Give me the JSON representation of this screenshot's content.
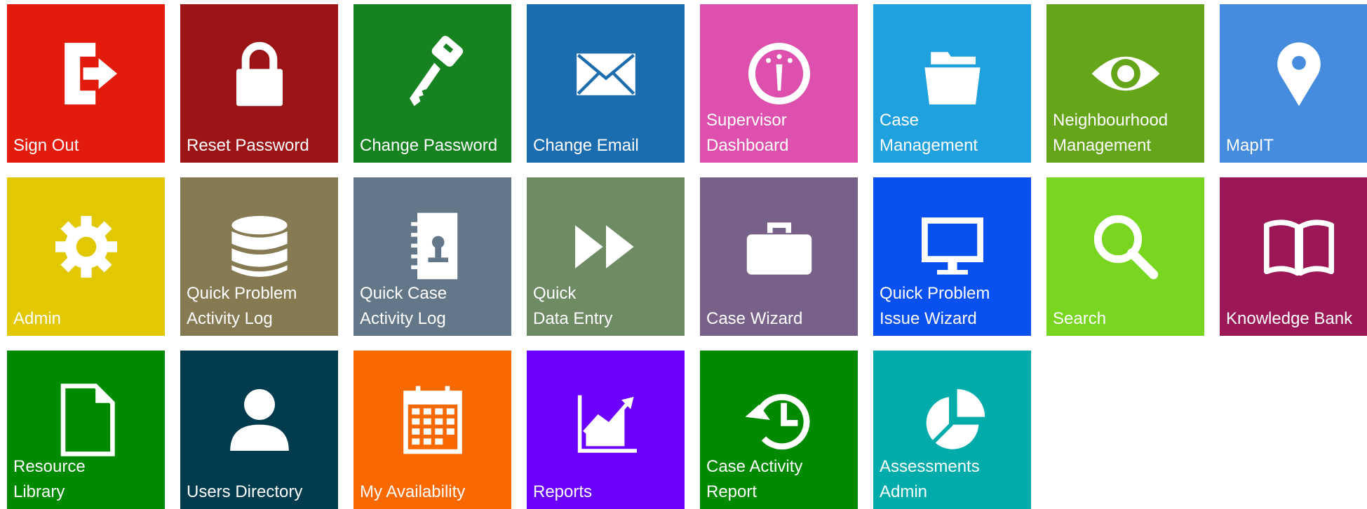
{
  "tiles": [
    {
      "id": "sign-out",
      "lines": [
        "Sign Out"
      ],
      "color": "#e31b0d",
      "icon": "sign-out-icon"
    },
    {
      "id": "reset-password",
      "lines": [
        "Reset Password"
      ],
      "color": "#9b1517",
      "icon": "lock-icon"
    },
    {
      "id": "change-password",
      "lines": [
        "Change Password"
      ],
      "color": "#168220",
      "icon": "key-icon"
    },
    {
      "id": "change-email",
      "lines": [
        "Change Email"
      ],
      "color": "#1c6daf",
      "icon": "envelope-icon"
    },
    {
      "id": "supervisor-dashboard",
      "lines": [
        "Supervisor",
        "Dashboard"
      ],
      "color": "#dd50ad",
      "icon": "gauge-icon"
    },
    {
      "id": "case-management",
      "lines": [
        "Case",
        "Management"
      ],
      "color": "#1fa1e0",
      "icon": "folder-icon"
    },
    {
      "id": "neighbourhood-management",
      "lines": [
        "Neighbourhood",
        "Management"
      ],
      "color": "#64a51a",
      "icon": "eye-icon"
    },
    {
      "id": "mapit",
      "lines": [
        "MapIT"
      ],
      "color": "#458cdf",
      "icon": "map-pin-icon"
    },
    {
      "id": "admin",
      "lines": [
        "Admin"
      ],
      "color": "#e2c800",
      "icon": "gear-icon"
    },
    {
      "id": "quick-problem-activity-log",
      "lines": [
        "Quick Problem",
        "Activity Log"
      ],
      "color": "#857a51",
      "icon": "database-icon"
    },
    {
      "id": "quick-case-activity-log",
      "lines": [
        "Quick Case",
        "Activity Log"
      ],
      "color": "#647789",
      "icon": "address-book-icon"
    },
    {
      "id": "quick-data-entry",
      "lines": [
        "Quick",
        "Data Entry"
      ],
      "color": "#6e8b63",
      "icon": "fast-forward-icon"
    },
    {
      "id": "case-wizard",
      "lines": [
        "Case Wizard"
      ],
      "color": "#786189",
      "icon": "briefcase-icon"
    },
    {
      "id": "quick-problem-issue-wizard",
      "lines": [
        "Quick Problem",
        "Issue Wizard"
      ],
      "color": "#0950f0",
      "icon": "monitor-icon"
    },
    {
      "id": "search",
      "lines": [
        "Search"
      ],
      "color": "#79d620",
      "icon": "search-icon"
    },
    {
      "id": "knowledge-bank",
      "lines": [
        "Knowledge Bank"
      ],
      "color": "#9b1755",
      "icon": "book-icon"
    },
    {
      "id": "resource-library",
      "lines": [
        "Resource",
        "Library"
      ],
      "color": "#008a00",
      "icon": "document-icon"
    },
    {
      "id": "users-directory",
      "lines": [
        "Users Directory"
      ],
      "color": "#003c4e",
      "icon": "user-icon"
    },
    {
      "id": "my-availability",
      "lines": [
        "My Availability"
      ],
      "color": "#fa6800",
      "icon": "calendar-icon"
    },
    {
      "id": "reports",
      "lines": [
        "Reports"
      ],
      "color": "#6b00ff",
      "icon": "chart-icon"
    },
    {
      "id": "case-activity-report",
      "lines": [
        "Case Activity",
        "Report"
      ],
      "color": "#008a00",
      "icon": "history-icon"
    },
    {
      "id": "assessments-admin",
      "lines": [
        "Assessments",
        "Admin"
      ],
      "color": "#00aca9",
      "icon": "pie-chart-icon"
    }
  ]
}
